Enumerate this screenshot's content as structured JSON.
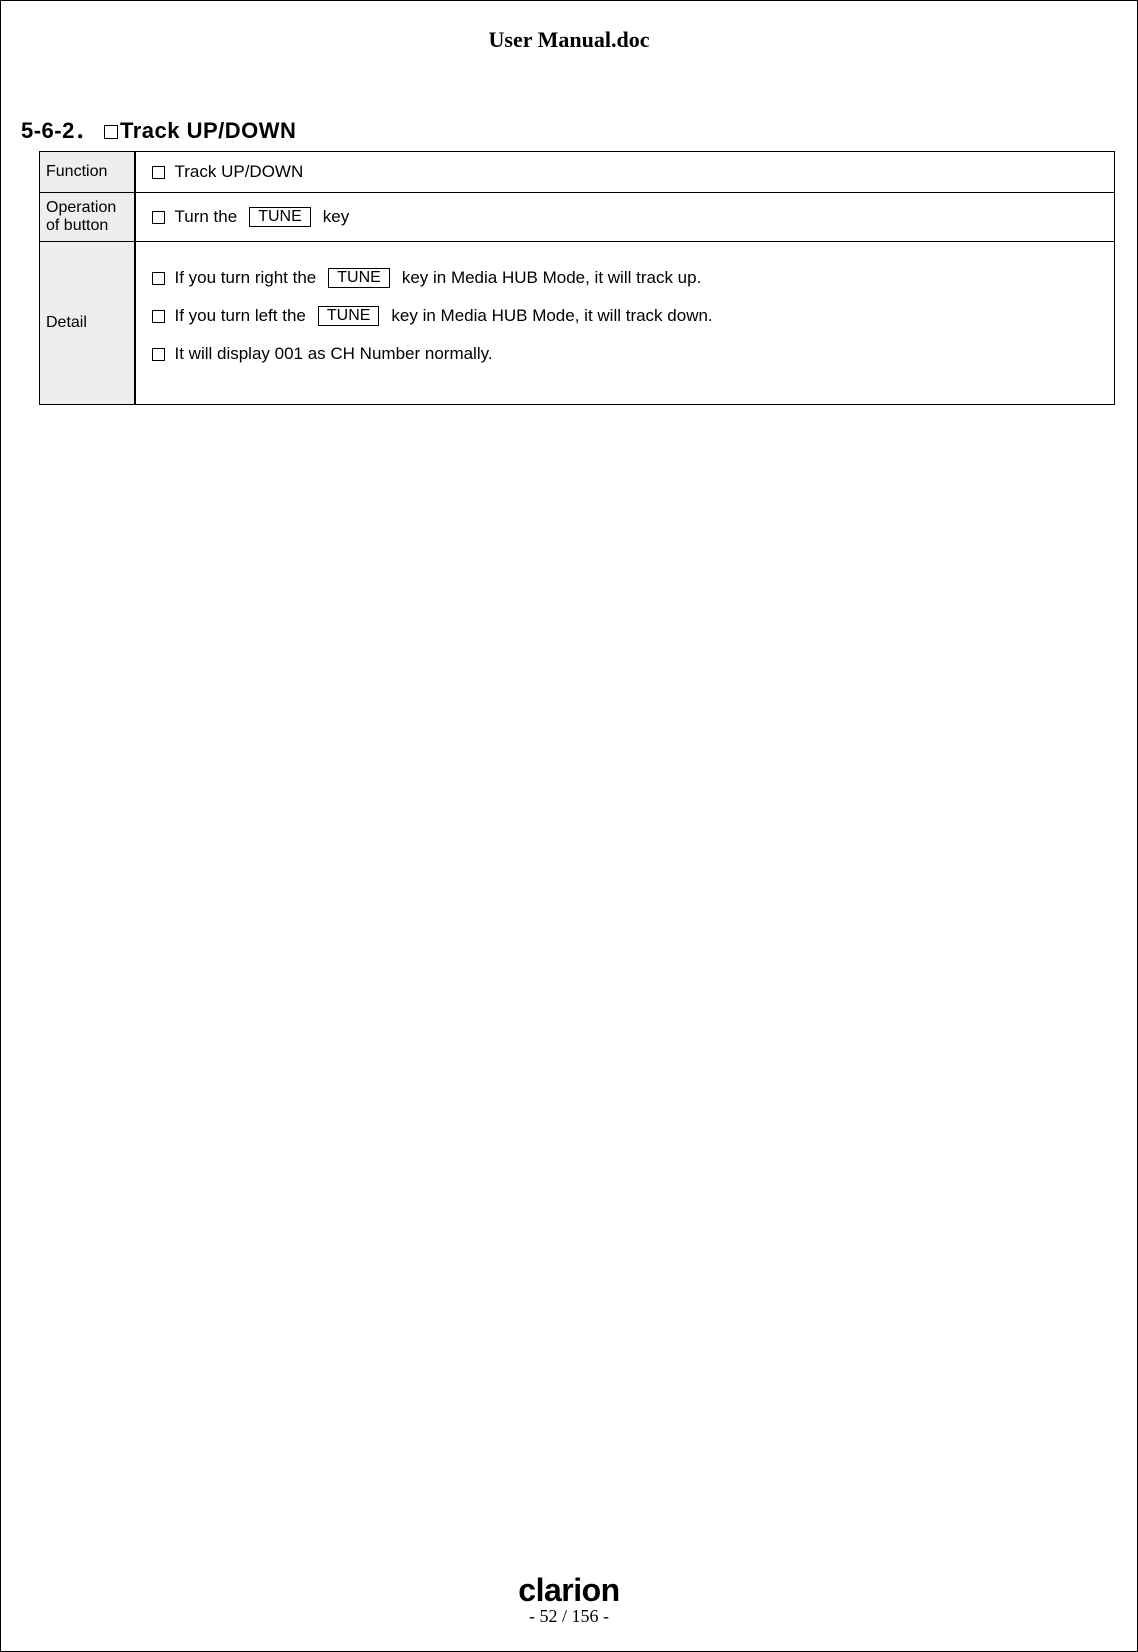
{
  "header": {
    "title": "User Manual.doc"
  },
  "section": {
    "number": "5-6-2．",
    "title": "Track UP/DOWN"
  },
  "table": {
    "rows": [
      {
        "label": "Function"
      },
      {
        "label": "Operation of button"
      },
      {
        "label": "Detail"
      }
    ],
    "function_text": "Track UP/DOWN",
    "operation": {
      "pre": "Turn the",
      "key": "TUNE",
      "post": "key"
    },
    "detail": [
      {
        "pre": "If you turn right the",
        "key": "TUNE",
        "post": "key in Media HUB Mode, it will track up."
      },
      {
        "pre": "If you turn left the",
        "key": "TUNE",
        "post": "key in Media HUB Mode, it will track down."
      },
      {
        "plain": "It will display 001 as CH Number normally."
      }
    ]
  },
  "footer": {
    "brand": "clarion",
    "page": "- 52 / 156 -"
  }
}
